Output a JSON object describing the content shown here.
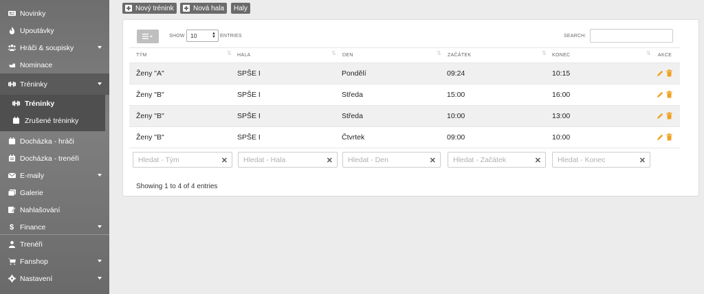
{
  "sidebar": {
    "items": [
      {
        "label": "Novinky",
        "icon": "newspaper-icon",
        "chevron": false
      },
      {
        "label": "Upoutávky",
        "icon": "fire-icon",
        "chevron": false
      },
      {
        "label": "Hráči & soupisky",
        "icon": "users-icon",
        "chevron": true
      },
      {
        "label": "Nominace",
        "icon": "hand-icon",
        "chevron": false
      },
      {
        "label": "Tréninky",
        "icon": "dumbbell-icon",
        "chevron": true
      },
      {
        "label": "Docházka - hráči",
        "icon": "calendar-icon",
        "chevron": false
      },
      {
        "label": "Docházka - trenéři",
        "icon": "calendar-icon",
        "chevron": false
      },
      {
        "label": "E-maily",
        "icon": "envelope-icon",
        "chevron": true
      },
      {
        "label": "Galerie",
        "icon": "images-icon",
        "chevron": false
      },
      {
        "label": "Nahlašování",
        "icon": "edit-icon",
        "chevron": false
      },
      {
        "label": "Finance",
        "icon": "dollar-icon",
        "chevron": true
      },
      {
        "label": "Trenéři",
        "icon": "user-icon",
        "chevron": false
      },
      {
        "label": "Fanshop",
        "icon": "cart-icon",
        "chevron": true
      },
      {
        "label": "Nastavení",
        "icon": "gear-icon",
        "chevron": true
      }
    ],
    "submenu": [
      {
        "label": "Tréninky",
        "icon": "dumbbell-icon"
      },
      {
        "label": "Zrušené tréninky",
        "icon": "calendar-icon"
      }
    ]
  },
  "toolbar": {
    "new_training": "Nový trénink",
    "new_hall": "Nová hala",
    "halls": "Haly"
  },
  "table": {
    "show_label": "SHOW",
    "entries_label": "ENTRIES",
    "page_size": "10",
    "search_label": "SEARCH:",
    "search_value": "",
    "columns": [
      "TÝM",
      "HALA",
      "DEN",
      "ZAČÁTEK",
      "KONEC",
      "AKCE"
    ],
    "rows": [
      {
        "team": "Ženy \"A\"",
        "hall": "SPŠE I",
        "day": "Pondělí",
        "start": "09:24",
        "end": "10:15"
      },
      {
        "team": "Ženy \"B\"",
        "hall": "SPŠE I",
        "day": "Středa",
        "start": "15:00",
        "end": "16:00"
      },
      {
        "team": "Ženy \"B\"",
        "hall": "SPŠE I",
        "day": "Středa",
        "start": "10:00",
        "end": "13:00"
      },
      {
        "team": "Ženy \"B\"",
        "hall": "SPŠE I",
        "day": "Čtvrtek",
        "start": "09:00",
        "end": "10:00"
      }
    ],
    "filters": {
      "team": "Hledat - Tým",
      "hall": "Hledat - Hala",
      "day": "Hledat - Den",
      "start": "Hledat - Začátek",
      "end": "Hledat - Konec"
    },
    "info": "Showing 1 to 4 of 4 entries"
  },
  "colors": {
    "accent": "#f0a020",
    "sidebar": "#6e6e6e"
  }
}
